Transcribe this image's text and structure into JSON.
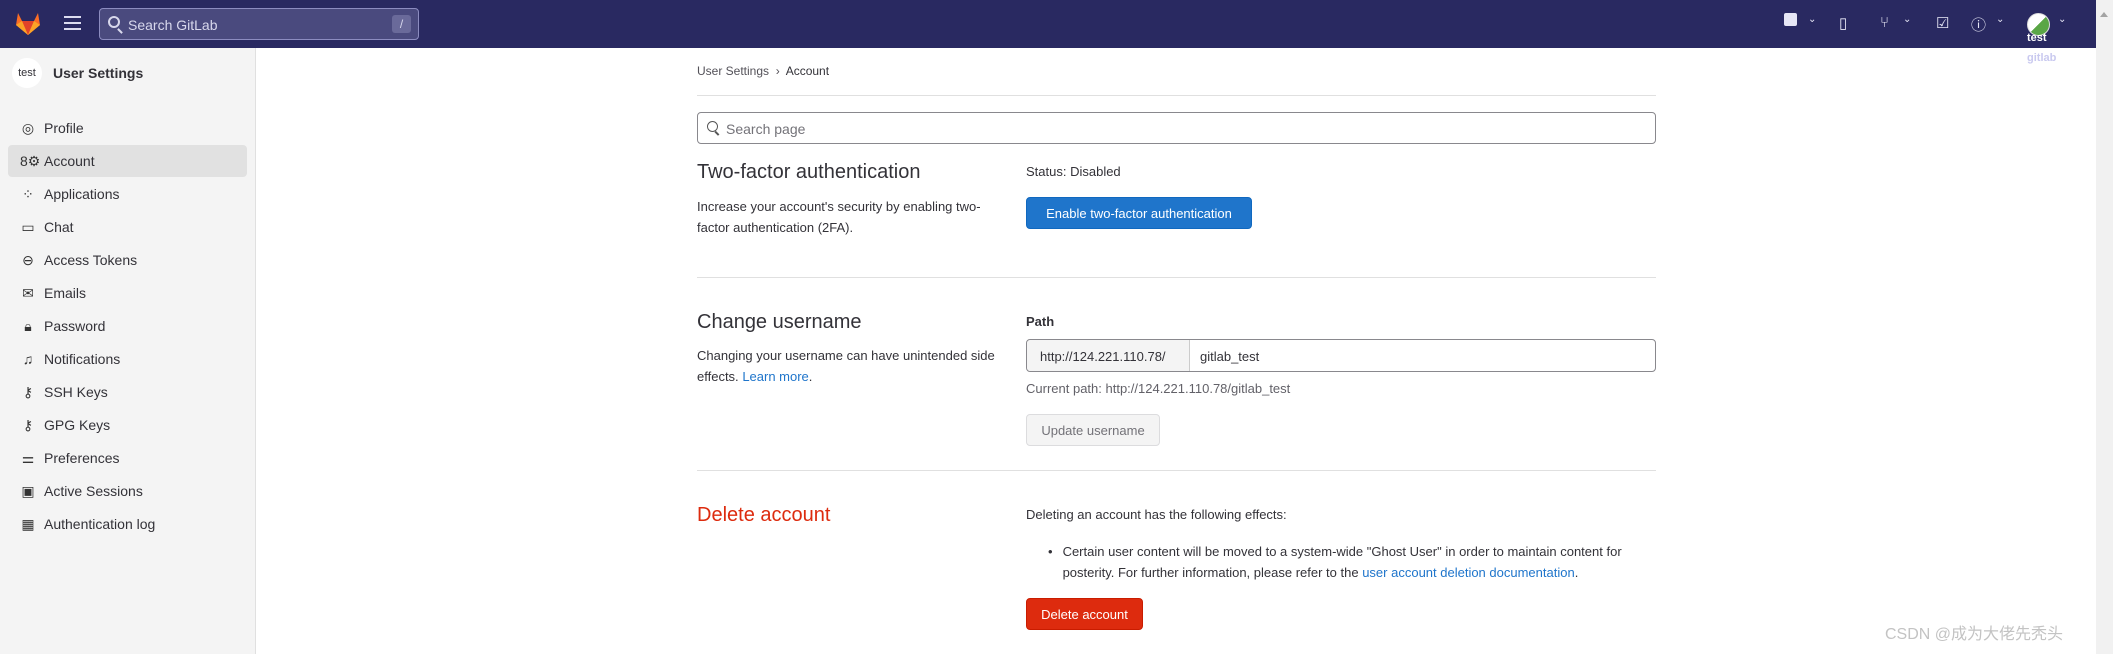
{
  "header": {
    "search_placeholder": "Search GitLab",
    "search_shortcut": "/",
    "user_name": "test",
    "user_sub": "gitlab"
  },
  "sidebar": {
    "title": "User Settings",
    "avatar_text": "test",
    "items": [
      {
        "label": "Profile",
        "icon": "profile-icon",
        "glyph": "◎"
      },
      {
        "label": "Account",
        "icon": "account-icon",
        "glyph": "8⚙"
      },
      {
        "label": "Applications",
        "icon": "applications-icon",
        "glyph": "⁘"
      },
      {
        "label": "Chat",
        "icon": "chat-icon",
        "glyph": "▭"
      },
      {
        "label": "Access Tokens",
        "icon": "token-icon",
        "glyph": "⊖"
      },
      {
        "label": "Emails",
        "icon": "mail-icon",
        "glyph": "✉"
      },
      {
        "label": "Password",
        "icon": "lock-icon",
        "glyph": "🔒︎"
      },
      {
        "label": "Notifications",
        "icon": "bell-icon",
        "glyph": "♫"
      },
      {
        "label": "SSH Keys",
        "icon": "key-icon",
        "glyph": "⚷"
      },
      {
        "label": "GPG Keys",
        "icon": "key-icon",
        "glyph": "⚷"
      },
      {
        "label": "Preferences",
        "icon": "preferences-icon",
        "glyph": "⚌"
      },
      {
        "label": "Active Sessions",
        "icon": "monitor-icon",
        "glyph": "▣"
      },
      {
        "label": "Authentication log",
        "icon": "log-icon",
        "glyph": "▦"
      }
    ],
    "active": "Account"
  },
  "breadcrumb": {
    "parent": "User Settings",
    "current": "Account"
  },
  "search_page_placeholder": "Search page",
  "two_factor": {
    "title": "Two-factor authentication",
    "desc": "Increase your account's security by enabling two-factor authentication (2FA).",
    "status": "Status: Disabled",
    "button": "Enable two-factor authentication"
  },
  "username": {
    "title": "Change username",
    "desc": "Changing your username can have unintended side effects.",
    "learn_more": "Learn more",
    "path_label": "Path",
    "prefix": "http://124.221.110.78/",
    "value": "gitlab_test",
    "current_path": "Current path: http://124.221.110.78/gitlab_test",
    "button": "Update username"
  },
  "delete": {
    "title": "Delete account",
    "intro": "Deleting an account has the following effects:",
    "bullet": "Certain user content will be moved to a system-wide \"Ghost User\" in order to maintain content for posterity. For further information, please refer to the",
    "bullet_link": "user account deletion documentation",
    "button": "Delete account"
  },
  "watermark": "CSDN @成为大佬先秃头",
  "colors": {
    "header": "#292961",
    "primary": "#1f75cb",
    "danger": "#dd2b0e"
  }
}
